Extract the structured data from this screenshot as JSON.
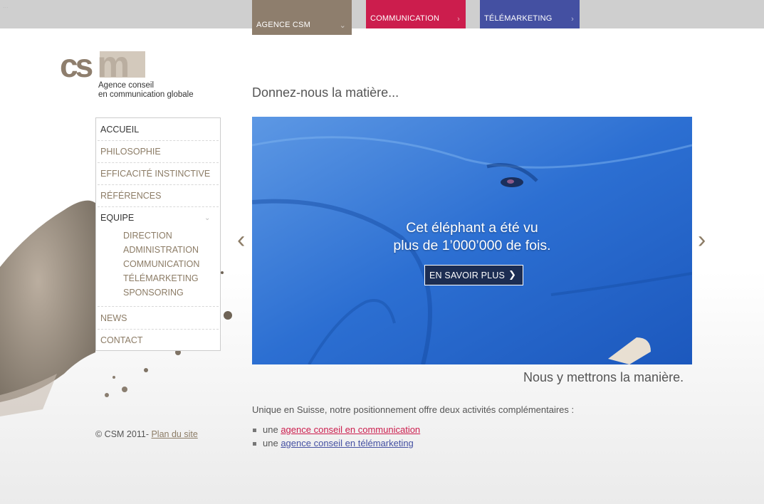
{
  "top_tabs": [
    {
      "label": "AGENCE CSM",
      "color": "#8e7e6d"
    },
    {
      "label": "COMMUNICATION",
      "color": "#cc1d4d"
    },
    {
      "label": "TÉLÉMARKETING",
      "color": "#4450a2"
    }
  ],
  "logo": {
    "mark": "csm",
    "tagline_line1": "Agence conseil",
    "tagline_line2": "en communication globale"
  },
  "nav": {
    "items": [
      {
        "label": "ACCUEIL"
      },
      {
        "label": "PHILOSOPHIE"
      },
      {
        "label": "EFFICACITÉ INSTINCTIVE"
      },
      {
        "label": "RÉFÉRENCES"
      },
      {
        "label": "EQUIPE"
      },
      {
        "label": "NEWS"
      },
      {
        "label": "CONTACT"
      }
    ],
    "sub_items": [
      {
        "label": "DIRECTION"
      },
      {
        "label": "ADMINISTRATION"
      },
      {
        "label": "COMMUNICATION"
      },
      {
        "label": "TÉLÉMARKETING"
      },
      {
        "label": "SPONSORING"
      }
    ]
  },
  "footer": {
    "copyright": "© CSM 2011-",
    "sitemap": "Plan du site"
  },
  "main": {
    "headline": "Donnez-nous la matière...",
    "banner_line1": "Cet éléphant a été vu",
    "banner_line2": "plus de 1’000’000 de fois.",
    "cta": "EN SAVOIR PLUS",
    "tagline": "Nous y mettrons la manière.",
    "intro": "Unique en Suisse, notre positionnement offre deux activités complémentaires :",
    "bullet_prefix": "une",
    "link_com": "agence conseil en communication",
    "link_tele": "agence conseil en télémarketing"
  },
  "colors": {
    "brand_brown": "#8e7e6d",
    "brand_red": "#cc1d4d",
    "brand_blue": "#4450a2"
  }
}
